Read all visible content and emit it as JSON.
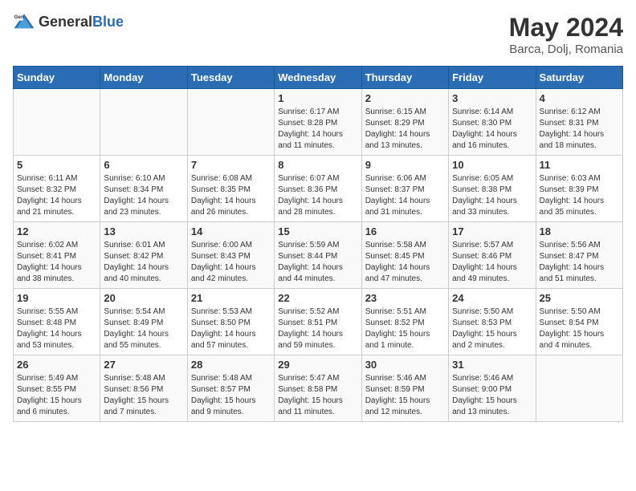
{
  "header": {
    "logo_general": "General",
    "logo_blue": "Blue",
    "title": "May 2024",
    "location": "Barca, Dolj, Romania"
  },
  "weekdays": [
    "Sunday",
    "Monday",
    "Tuesday",
    "Wednesday",
    "Thursday",
    "Friday",
    "Saturday"
  ],
  "weeks": [
    [
      {
        "day": "",
        "info": ""
      },
      {
        "day": "",
        "info": ""
      },
      {
        "day": "",
        "info": ""
      },
      {
        "day": "1",
        "info": "Sunrise: 6:17 AM\nSunset: 8:28 PM\nDaylight: 14 hours\nand 11 minutes."
      },
      {
        "day": "2",
        "info": "Sunrise: 6:15 AM\nSunset: 8:29 PM\nDaylight: 14 hours\nand 13 minutes."
      },
      {
        "day": "3",
        "info": "Sunrise: 6:14 AM\nSunset: 8:30 PM\nDaylight: 14 hours\nand 16 minutes."
      },
      {
        "day": "4",
        "info": "Sunrise: 6:12 AM\nSunset: 8:31 PM\nDaylight: 14 hours\nand 18 minutes."
      }
    ],
    [
      {
        "day": "5",
        "info": "Sunrise: 6:11 AM\nSunset: 8:32 PM\nDaylight: 14 hours\nand 21 minutes."
      },
      {
        "day": "6",
        "info": "Sunrise: 6:10 AM\nSunset: 8:34 PM\nDaylight: 14 hours\nand 23 minutes."
      },
      {
        "day": "7",
        "info": "Sunrise: 6:08 AM\nSunset: 8:35 PM\nDaylight: 14 hours\nand 26 minutes."
      },
      {
        "day": "8",
        "info": "Sunrise: 6:07 AM\nSunset: 8:36 PM\nDaylight: 14 hours\nand 28 minutes."
      },
      {
        "day": "9",
        "info": "Sunrise: 6:06 AM\nSunset: 8:37 PM\nDaylight: 14 hours\nand 31 minutes."
      },
      {
        "day": "10",
        "info": "Sunrise: 6:05 AM\nSunset: 8:38 PM\nDaylight: 14 hours\nand 33 minutes."
      },
      {
        "day": "11",
        "info": "Sunrise: 6:03 AM\nSunset: 8:39 PM\nDaylight: 14 hours\nand 35 minutes."
      }
    ],
    [
      {
        "day": "12",
        "info": "Sunrise: 6:02 AM\nSunset: 8:41 PM\nDaylight: 14 hours\nand 38 minutes."
      },
      {
        "day": "13",
        "info": "Sunrise: 6:01 AM\nSunset: 8:42 PM\nDaylight: 14 hours\nand 40 minutes."
      },
      {
        "day": "14",
        "info": "Sunrise: 6:00 AM\nSunset: 8:43 PM\nDaylight: 14 hours\nand 42 minutes."
      },
      {
        "day": "15",
        "info": "Sunrise: 5:59 AM\nSunset: 8:44 PM\nDaylight: 14 hours\nand 44 minutes."
      },
      {
        "day": "16",
        "info": "Sunrise: 5:58 AM\nSunset: 8:45 PM\nDaylight: 14 hours\nand 47 minutes."
      },
      {
        "day": "17",
        "info": "Sunrise: 5:57 AM\nSunset: 8:46 PM\nDaylight: 14 hours\nand 49 minutes."
      },
      {
        "day": "18",
        "info": "Sunrise: 5:56 AM\nSunset: 8:47 PM\nDaylight: 14 hours\nand 51 minutes."
      }
    ],
    [
      {
        "day": "19",
        "info": "Sunrise: 5:55 AM\nSunset: 8:48 PM\nDaylight: 14 hours\nand 53 minutes."
      },
      {
        "day": "20",
        "info": "Sunrise: 5:54 AM\nSunset: 8:49 PM\nDaylight: 14 hours\nand 55 minutes."
      },
      {
        "day": "21",
        "info": "Sunrise: 5:53 AM\nSunset: 8:50 PM\nDaylight: 14 hours\nand 57 minutes."
      },
      {
        "day": "22",
        "info": "Sunrise: 5:52 AM\nSunset: 8:51 PM\nDaylight: 14 hours\nand 59 minutes."
      },
      {
        "day": "23",
        "info": "Sunrise: 5:51 AM\nSunset: 8:52 PM\nDaylight: 15 hours\nand 1 minute."
      },
      {
        "day": "24",
        "info": "Sunrise: 5:50 AM\nSunset: 8:53 PM\nDaylight: 15 hours\nand 2 minutes."
      },
      {
        "day": "25",
        "info": "Sunrise: 5:50 AM\nSunset: 8:54 PM\nDaylight: 15 hours\nand 4 minutes."
      }
    ],
    [
      {
        "day": "26",
        "info": "Sunrise: 5:49 AM\nSunset: 8:55 PM\nDaylight: 15 hours\nand 6 minutes."
      },
      {
        "day": "27",
        "info": "Sunrise: 5:48 AM\nSunset: 8:56 PM\nDaylight: 15 hours\nand 7 minutes."
      },
      {
        "day": "28",
        "info": "Sunrise: 5:48 AM\nSunset: 8:57 PM\nDaylight: 15 hours\nand 9 minutes."
      },
      {
        "day": "29",
        "info": "Sunrise: 5:47 AM\nSunset: 8:58 PM\nDaylight: 15 hours\nand 11 minutes."
      },
      {
        "day": "30",
        "info": "Sunrise: 5:46 AM\nSunset: 8:59 PM\nDaylight: 15 hours\nand 12 minutes."
      },
      {
        "day": "31",
        "info": "Sunrise: 5:46 AM\nSunset: 9:00 PM\nDaylight: 15 hours\nand 13 minutes."
      },
      {
        "day": "",
        "info": ""
      }
    ]
  ]
}
